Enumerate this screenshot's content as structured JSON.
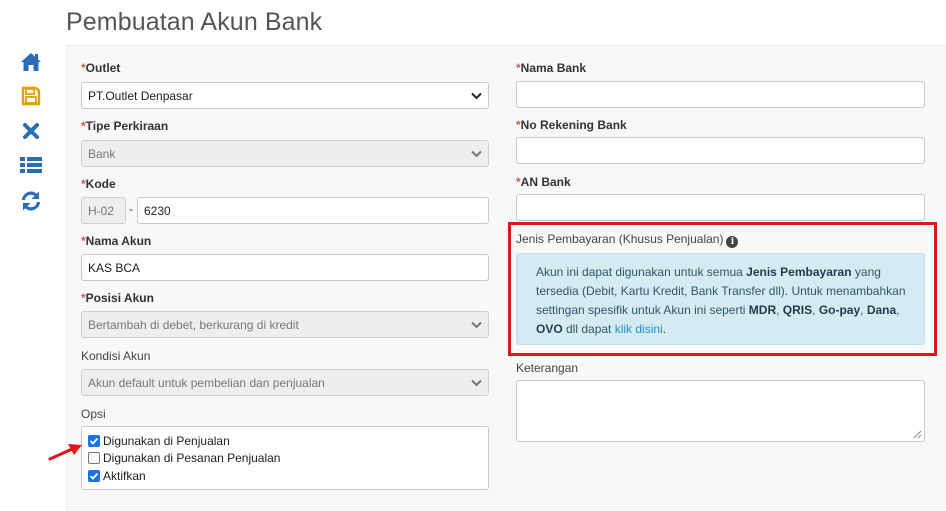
{
  "page": {
    "title": "Pembuatan Akun Bank"
  },
  "sidebar": {
    "icons": [
      "home-icon",
      "save-icon",
      "close-icon",
      "list-icon",
      "refresh-icon"
    ],
    "color": "#2a6db5"
  },
  "form": {
    "required_mark": "*",
    "outlet": {
      "label": "Outlet",
      "value": "PT.Outlet Denpasar"
    },
    "tipe_perkiraan": {
      "label": "Tipe Perkiraan",
      "value": "Bank"
    },
    "kode": {
      "label": "Kode",
      "prefix": "H-02",
      "separator": "-",
      "value": "6230"
    },
    "nama_akun": {
      "label": "Nama Akun",
      "value": "KAS BCA"
    },
    "posisi_akun": {
      "label": "Posisi Akun",
      "value": "Bertambah di debet, berkurang di kredit"
    },
    "kondisi_akun": {
      "label": "Kondisi Akun",
      "value": "Akun default untuk pembelian dan penjualan"
    },
    "opsi": {
      "label": "Opsi",
      "items": [
        {
          "label": "Digunakan di Penjualan",
          "checked": true
        },
        {
          "label": "Digunakan di Pesanan Penjualan",
          "checked": false
        },
        {
          "label": "Aktifkan",
          "checked": true
        }
      ]
    },
    "nama_bank": {
      "label": "Nama Bank",
      "value": ""
    },
    "no_rekening": {
      "label": "No Rekening Bank",
      "value": ""
    },
    "an_bank": {
      "label": "AN Bank",
      "value": ""
    },
    "jenis_pembayaran": {
      "label": "Jenis Pembayaran (Khusus Penjualan)",
      "info_icon": "info-icon",
      "alert": {
        "t1": "Akun ini dapat digunakan untuk semua ",
        "b1": "Jenis Pembayaran",
        "t2": " yang tersedia (Debit, Kartu Kredit, Bank Transfer dll). Untuk menambahkan settingan spesifik untuk Akun ini seperti ",
        "b2": "MDR",
        "t3": ", ",
        "b3": "QRIS",
        "t4": ", ",
        "b4": "Go-pay",
        "t5": ", ",
        "b5": "Dana",
        "t6": ", ",
        "b6": "OVO",
        "t7": " dll dapat ",
        "link": "klik disini",
        "t8": "."
      }
    },
    "keterangan": {
      "label": "Keterangan",
      "value": ""
    }
  },
  "annotation": {
    "highlight_color": "#e3141d",
    "arrow_color": "#e3141d"
  }
}
